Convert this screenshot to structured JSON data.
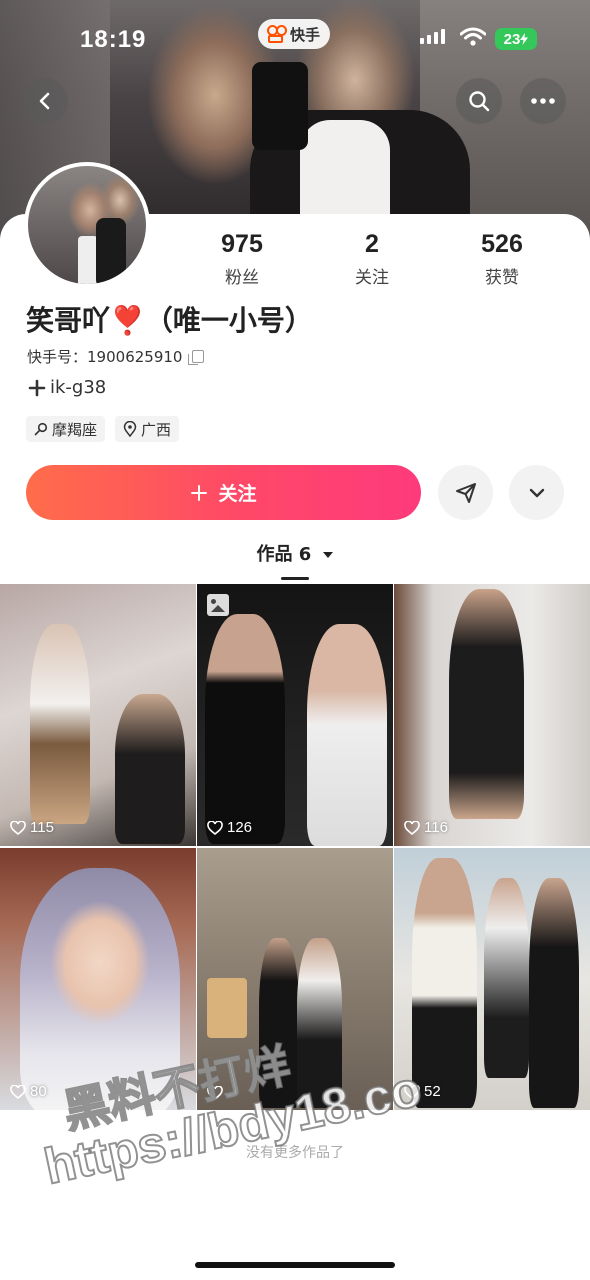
{
  "status_bar": {
    "time": "18:19",
    "battery": "23"
  },
  "app_pill": {
    "name": "快手"
  },
  "profile": {
    "stats": [
      {
        "value": "975",
        "label": "粉丝"
      },
      {
        "value": "2",
        "label": "关注"
      },
      {
        "value": "526",
        "label": "获赞"
      }
    ],
    "name": "笑哥吖❣️（唯一小号）",
    "id_label": "快手号：",
    "id_value": "1900625910",
    "extra": "ik-g38",
    "tags": [
      {
        "icon": "zodiac-icon",
        "label": "摩羯座"
      },
      {
        "icon": "location-pin-icon",
        "label": "广西"
      }
    ],
    "follow_label": "关注"
  },
  "tab": {
    "label": "作品 6"
  },
  "works": [
    {
      "likes": "115"
    },
    {
      "likes": "126",
      "badge": "image-icon"
    },
    {
      "likes": "116"
    },
    {
      "likes": "80"
    },
    {
      "likes": ""
    },
    {
      "likes": "52"
    }
  ],
  "end_text": "没有更多作品了",
  "watermark": {
    "line1": "黑料不打烊",
    "line2": "https://bdy18.co"
  },
  "colors": {
    "follow_gradient_start": "#ff6d4a",
    "follow_gradient_end": "#fe3a7c",
    "battery": "#34c759",
    "brand": "#ff5000"
  }
}
